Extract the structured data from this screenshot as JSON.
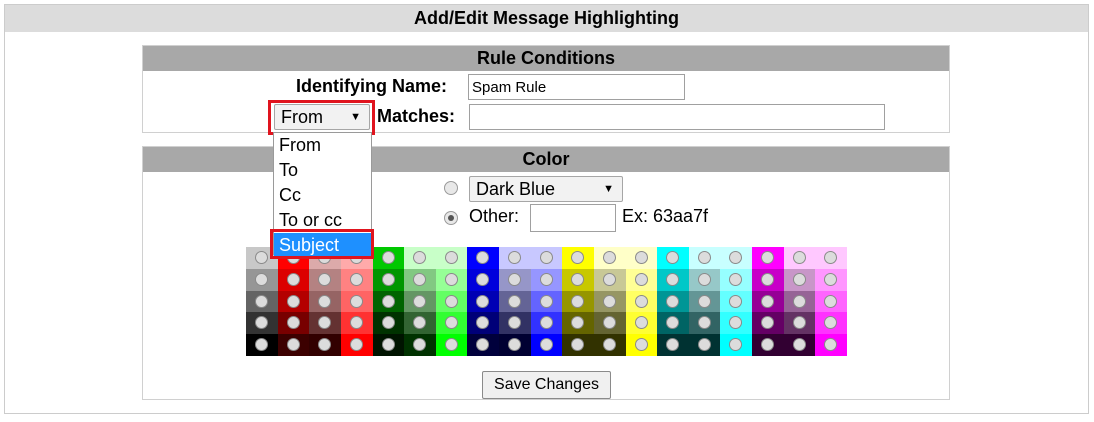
{
  "page_title": "Add/Edit Message Highlighting",
  "rule_conditions": {
    "title": "Rule Conditions",
    "identifying_name_label": "Identifying Name:",
    "identifying_name_value": "Spam Rule",
    "field_select_value": "From",
    "matches_label": "Matches:",
    "matches_value": ""
  },
  "dropdown_options": [
    "From",
    "To",
    "Cc",
    "To or cc",
    "Subject"
  ],
  "dropdown_highlighted": "Subject",
  "color": {
    "title": "Color",
    "preset_select_value": "Dark Blue",
    "other_label": "Other:",
    "other_value": "",
    "example_text": "Ex: 63aa7f",
    "selected_option": "other"
  },
  "swatch_colors": [
    [
      "#c8c8c8",
      "#ff0000",
      "#dcaaaa",
      "#ffaaaa",
      "#00c800",
      "#c8ffc8",
      "#c8ffc8",
      "#0000ff",
      "#c8c8ff",
      "#c8c8ff",
      "#ffff00",
      "#ffffc8",
      "#ffffc8",
      "#00ffff",
      "#c8ffff",
      "#c8ffff",
      "#ff00ff",
      "#ffc8ff",
      "#ffc8ff"
    ],
    [
      "#969696",
      "#dc0000",
      "#b48282",
      "#ff8282",
      "#009600",
      "#82c882",
      "#96ff96",
      "#0000dc",
      "#9696c8",
      "#9696ff",
      "#c8c800",
      "#c8c896",
      "#ffff96",
      "#00c8c8",
      "#96c8c8",
      "#96ffff",
      "#c800c8",
      "#c896c8",
      "#ff96ff"
    ],
    [
      "#646464",
      "#b40000",
      "#966464",
      "#ff6464",
      "#006400",
      "#649664",
      "#64ff64",
      "#0000b4",
      "#646496",
      "#6464ff",
      "#969600",
      "#969664",
      "#ffff64",
      "#009696",
      "#649696",
      "#64ffff",
      "#960096",
      "#966496",
      "#ff64ff"
    ],
    [
      "#323232",
      "#780000",
      "#643232",
      "#ff3232",
      "#003200",
      "#326432",
      "#32ff32",
      "#000078",
      "#323264",
      "#3232ff",
      "#646400",
      "#646432",
      "#ffff32",
      "#006464",
      "#326464",
      "#32ffff",
      "#640064",
      "#643264",
      "#ff32ff"
    ],
    [
      "#000000",
      "#3c0000",
      "#320000",
      "#ff0000",
      "#001400",
      "#003200",
      "#00ff00",
      "#00003c",
      "#000032",
      "#0000ff",
      "#323200",
      "#323200",
      "#ffff00",
      "#003232",
      "#003232",
      "#00ffff",
      "#320032",
      "#320032",
      "#ff00ff"
    ]
  ],
  "save_button_label": "Save Changes"
}
